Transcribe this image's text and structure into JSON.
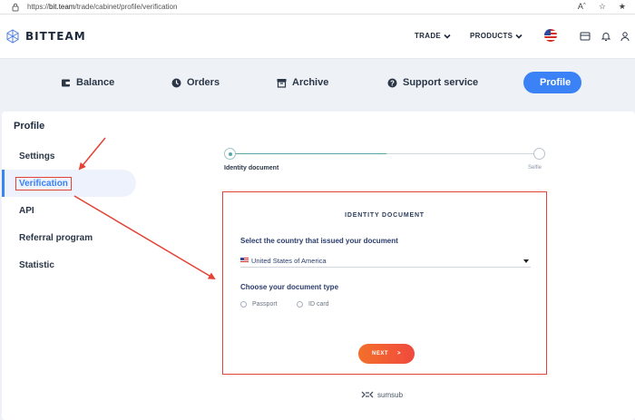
{
  "browser": {
    "url_prefix": "https://",
    "url_host": "bit.team",
    "url_path": "/trade/cabinet/profile/verification",
    "icons": [
      "read-aloud-icon",
      "favorites-star-icon",
      "collections-icon"
    ]
  },
  "header": {
    "logo_text": "BITTEAM",
    "nav": [
      {
        "label": "TRADE"
      },
      {
        "label": "PRODUCTS"
      }
    ],
    "icons": [
      "us-flag-icon",
      "wallet-icon",
      "bell-icon",
      "user-icon"
    ]
  },
  "tabs": [
    {
      "label": "Balance",
      "icon": "wallet-icon"
    },
    {
      "label": "Orders",
      "icon": "clock-icon"
    },
    {
      "label": "Archive",
      "icon": "archive-icon"
    },
    {
      "label": "Support service",
      "icon": "question-circle-icon"
    },
    {
      "label": "Profile",
      "icon": "user-icon",
      "active": true
    }
  ],
  "profile": {
    "title": "Profile",
    "sidebar": [
      {
        "label": "Settings"
      },
      {
        "label": "Verification",
        "active": true
      },
      {
        "label": "API"
      },
      {
        "label": "Referral program"
      },
      {
        "label": "Statistic"
      }
    ]
  },
  "stepper": {
    "steps": [
      {
        "label": "Identity document",
        "active": true
      },
      {
        "label": "Selfie"
      }
    ]
  },
  "identity": {
    "title": "IDENTITY DOCUMENT",
    "country_label": "Select the country that issued your document",
    "country_value": "United States of America",
    "doc_type_label": "Choose your document type",
    "doc_types": [
      {
        "label": "Passport"
      },
      {
        "label": "ID card"
      }
    ],
    "next_label": "NEXT",
    "next_arrow": ">"
  },
  "footer": {
    "brand": "sumsub"
  },
  "colors": {
    "accent": "#3b82f6",
    "annotation_red": "#e34234",
    "stepper_teal": "#5aa6a8",
    "next_orange": "#f36f2a"
  }
}
